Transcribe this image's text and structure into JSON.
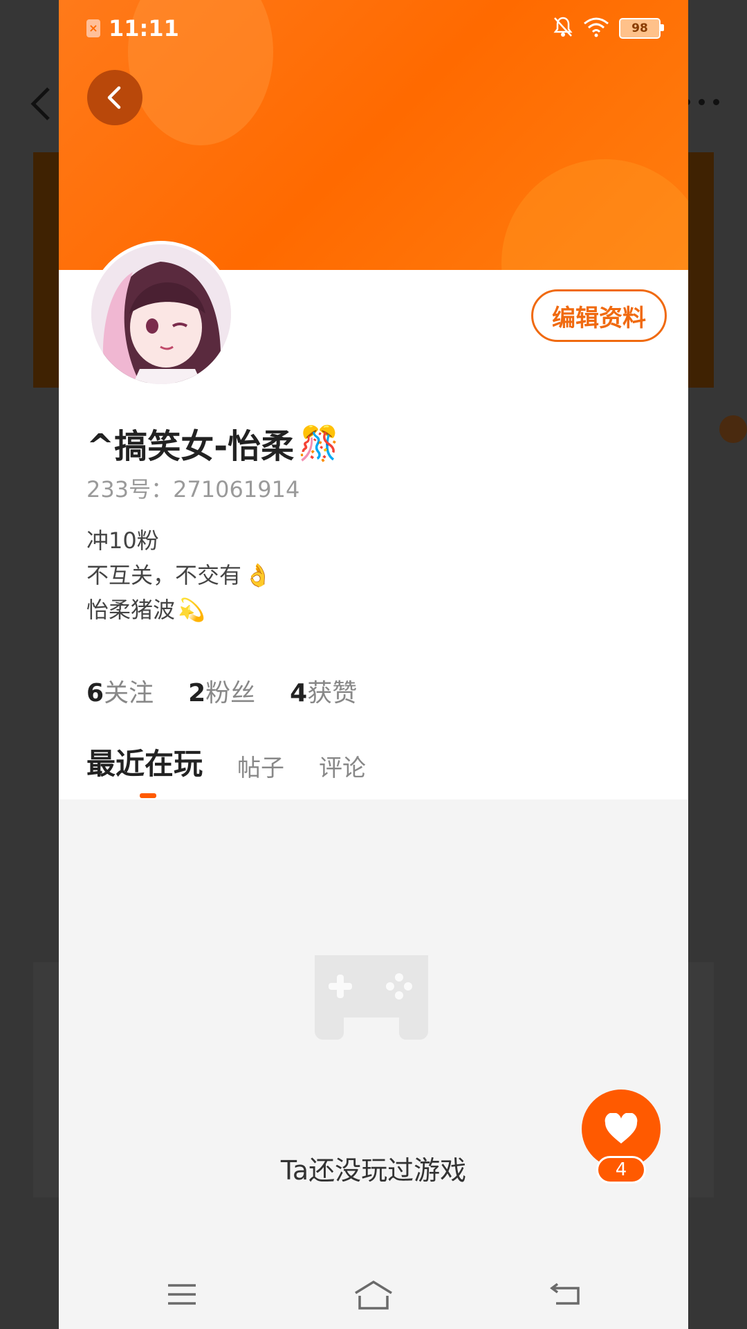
{
  "status_bar": {
    "time": "11:11",
    "battery": "98",
    "icons": [
      "sim-card-icon",
      "bell-muted-icon",
      "wifi-icon",
      "battery-icon"
    ]
  },
  "profile": {
    "name": "^搞笑女-怡柔",
    "name_emoji": "🎊",
    "uid": "233号：271061914",
    "edit_button": "编辑资料",
    "bio": [
      {
        "text": "冲10粉",
        "emoji": ""
      },
      {
        "text": "不互关，不交有",
        "emoji": "👌"
      },
      {
        "text": "怡柔猪波",
        "emoji": "💫"
      }
    ]
  },
  "stats": [
    {
      "value": "6",
      "label": "关注"
    },
    {
      "value": "2",
      "label": "粉丝"
    },
    {
      "value": "4",
      "label": "获赞"
    }
  ],
  "tabs": [
    {
      "label": "最近在玩",
      "active": true
    },
    {
      "label": "帖子",
      "active": false
    },
    {
      "label": "评论",
      "active": false
    }
  ],
  "empty_state": {
    "text": "Ta还没玩过游戏",
    "icon": "gamepad-icon"
  },
  "like": {
    "count": "4",
    "icon": "heart-icon"
  },
  "nav": {
    "icons": [
      "menu-icon",
      "home-icon",
      "back-icon"
    ]
  },
  "colors": {
    "accent": "#ff5a00",
    "header": "#ff6f0a"
  }
}
